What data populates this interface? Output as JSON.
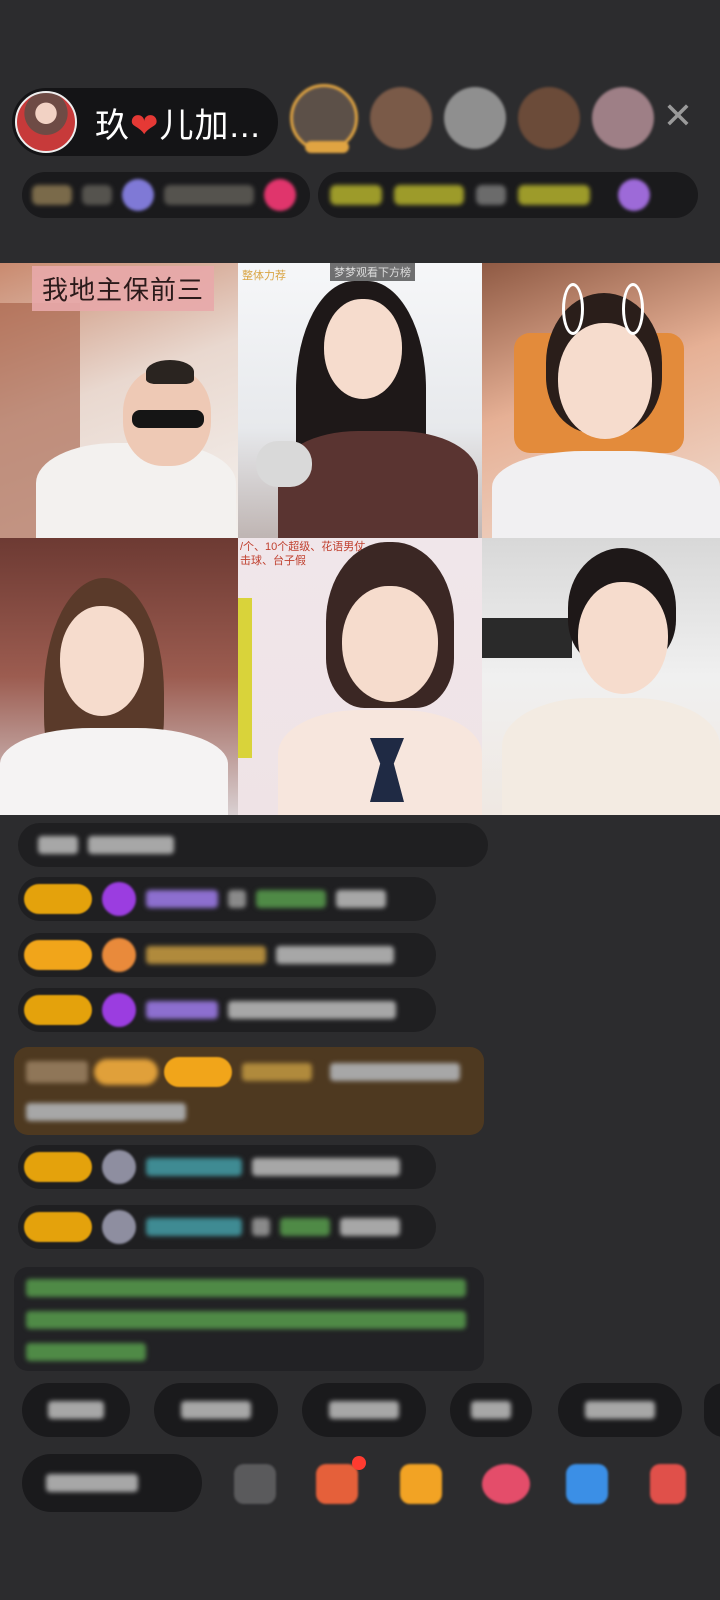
{
  "header": {
    "anchor_name_prefix": "玖",
    "heart_glyph": "❤",
    "anchor_name_suffix": "儿加...",
    "close_glyph": "✕"
  },
  "video_grid": {
    "cells": [
      {
        "caption": "我地主保前三"
      },
      {
        "tag_left": "整体力荐",
        "tag_center": "梦梦观看下方榜"
      },
      {},
      {},
      {
        "note": "/个、10个超级、花语男仗\n击球、台子假"
      },
      {}
    ]
  },
  "colors": {
    "background": "#2c2c2e",
    "badge_gold": "#e4a20c",
    "highlight_amber": "#4e3920",
    "close_gray": "#9a9a9a"
  }
}
